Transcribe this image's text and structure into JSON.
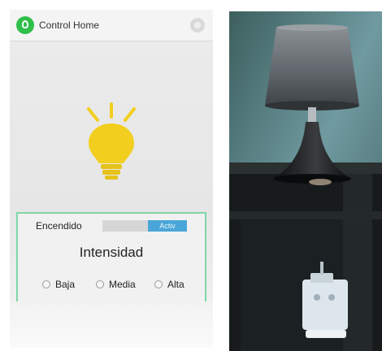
{
  "app": {
    "title": "Control Home"
  },
  "control": {
    "power_label": "Encendido",
    "power_state": "Activ",
    "intensity_title": "Intensidad",
    "options": [
      {
        "label": "Baja",
        "selected": false
      },
      {
        "label": "Media",
        "selected": false
      },
      {
        "label": "Alta",
        "selected": false
      }
    ]
  },
  "icons": {
    "app": "light-bulb-app-icon",
    "overflow": "overflow-menu-icon",
    "bulb": "light-bulb-icon",
    "radio": "radio-button-icon"
  },
  "colors": {
    "bulb": "#f2cf1f",
    "toggle_on": "#4aa6d8",
    "card_border": "#7fd7a7",
    "app_icon": "#2fbf4a"
  }
}
